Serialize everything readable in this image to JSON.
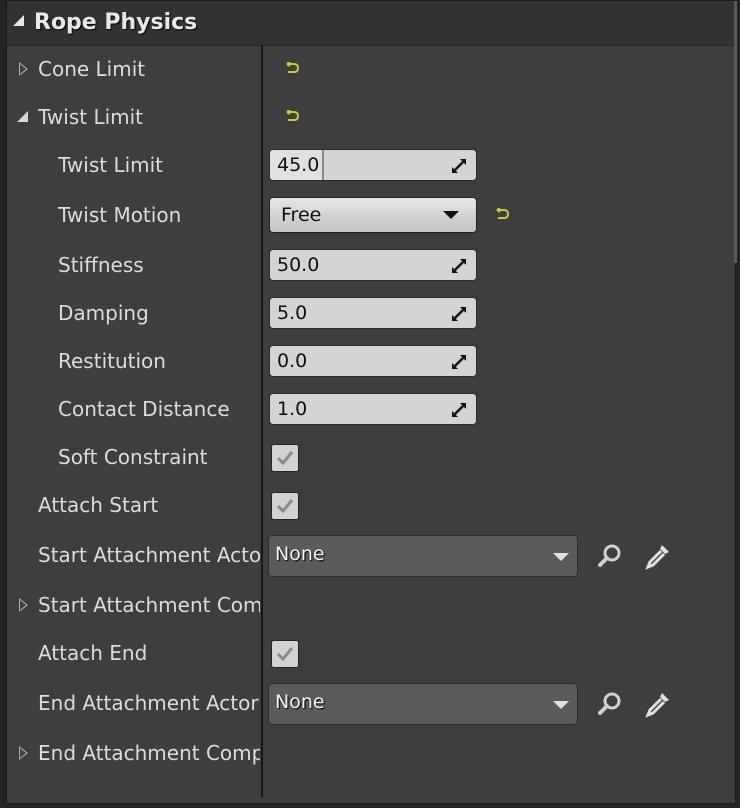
{
  "section": {
    "title": "Rope Physics"
  },
  "rows": {
    "cone_limit": {
      "label": "Cone Limit"
    },
    "twist_limit_group": {
      "label": "Twist Limit"
    },
    "twist_limit": {
      "label": "Twist Limit",
      "value": "45.0",
      "slider_fraction": 0.25
    },
    "twist_motion": {
      "label": "Twist Motion",
      "value": "Free"
    },
    "stiffness": {
      "label": "Stiffness",
      "value": "50.0"
    },
    "damping": {
      "label": "Damping",
      "value": "5.0"
    },
    "restitution": {
      "label": "Restitution",
      "value": "0.0"
    },
    "contact_distance": {
      "label": "Contact Distance",
      "value": "1.0"
    },
    "soft_constraint": {
      "label": "Soft Constraint",
      "checked": true
    },
    "attach_start": {
      "label": "Attach Start",
      "checked": true
    },
    "start_attachment_actor": {
      "label": "Start Attachment Actor",
      "value": "None"
    },
    "start_attachment_component": {
      "label": "Start Attachment Component"
    },
    "attach_end": {
      "label": "Attach End",
      "checked": true
    },
    "end_attachment_actor": {
      "label": "End Attachment Actor",
      "value": "None"
    },
    "end_attachment_component": {
      "label": "End Attachment Component"
    }
  },
  "icons": {
    "reset": "reset-to-default-icon",
    "expand": "expand-arrow-icon",
    "collapse": "collapse-arrow-icon",
    "browse": "magnifier-icon",
    "pick": "eyedropper-icon",
    "spin": "drag-arrows-icon"
  },
  "colors": {
    "reset_arrow": "#c8c83a",
    "panel_bg": "#3e3e3e",
    "header_bg": "#323232"
  }
}
